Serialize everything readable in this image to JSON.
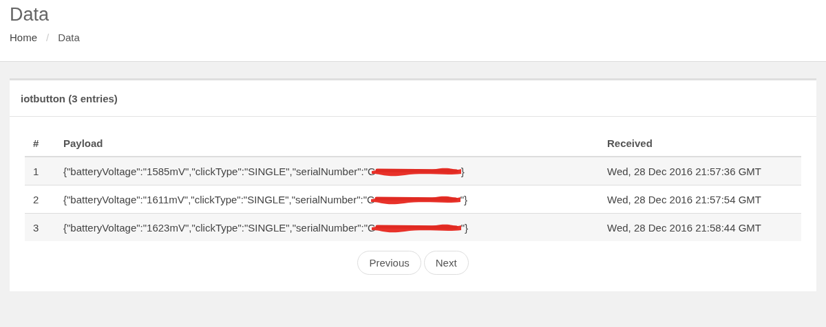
{
  "page": {
    "title": "Data"
  },
  "breadcrumb": [
    {
      "label": "Home",
      "selected": false
    },
    {
      "separator": "/",
      "label": "Data",
      "selected": true
    }
  ],
  "panel": {
    "title": "iotbutton (3 entries)",
    "table": {
      "columns": [
        "#",
        "Payload",
        "Received"
      ],
      "rows": [
        {
          "index": "1",
          "payload_before": "{\"batteryVoltage\":\"1585mV\",\"clickType\":\"SINGLE\",\"serialNumber\":\"G",
          "redacted": true,
          "payload_after": "}",
          "received": "Wed, 28 Dec 2016 21:57:36 GMT"
        },
        {
          "index": "2",
          "payload_before": "{\"batteryVoltage\":\"1611mV\",\"clickType\":\"SINGLE\",\"serialNumber\":\"G",
          "redacted": true,
          "payload_after": "\"}",
          "received": "Wed, 28 Dec 2016 21:57:54 GMT"
        },
        {
          "index": "3",
          "payload_before": "{\"batteryVoltage\":\"1623mV\",\"clickType\":\"SINGLE\",\"serialNumber\":\"G",
          "redacted": true,
          "payload_after": "\"}",
          "received": "Wed, 28 Dec 2016 21:58:44 GMT"
        }
      ]
    },
    "pagination": [
      "Previous",
      "Next"
    ]
  }
}
